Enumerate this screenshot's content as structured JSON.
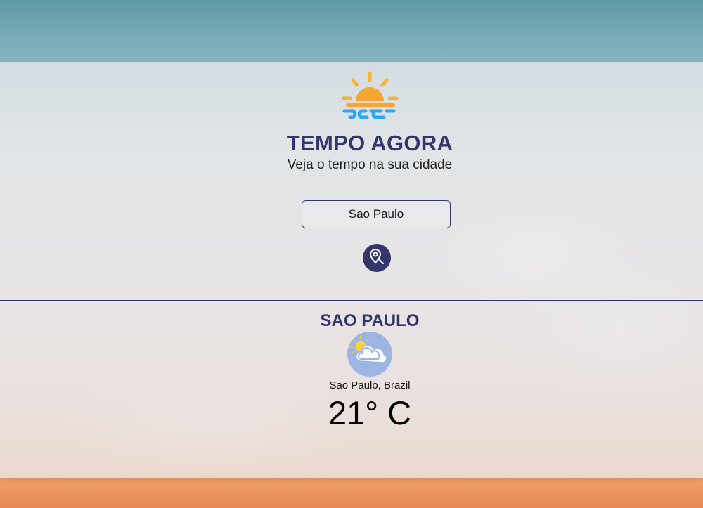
{
  "header": {
    "title": "TEMPO AGORA",
    "subtitle": "Veja o tempo na sua cidade",
    "logo_icon": "sun-over-waves-icon"
  },
  "search": {
    "value": "Sao Paulo",
    "button_icon": "location-search-icon"
  },
  "result": {
    "city_heading": "SAO PAULO",
    "weather_icon": "partly-cloudy-icon",
    "location": "Sao Paulo, Brazil",
    "temperature": "21° C"
  },
  "colors": {
    "accent": "#34356b",
    "sun_orange": "#f7a531",
    "wave_blue": "#2aa7f0",
    "icon_badge": "#9db5e3"
  }
}
